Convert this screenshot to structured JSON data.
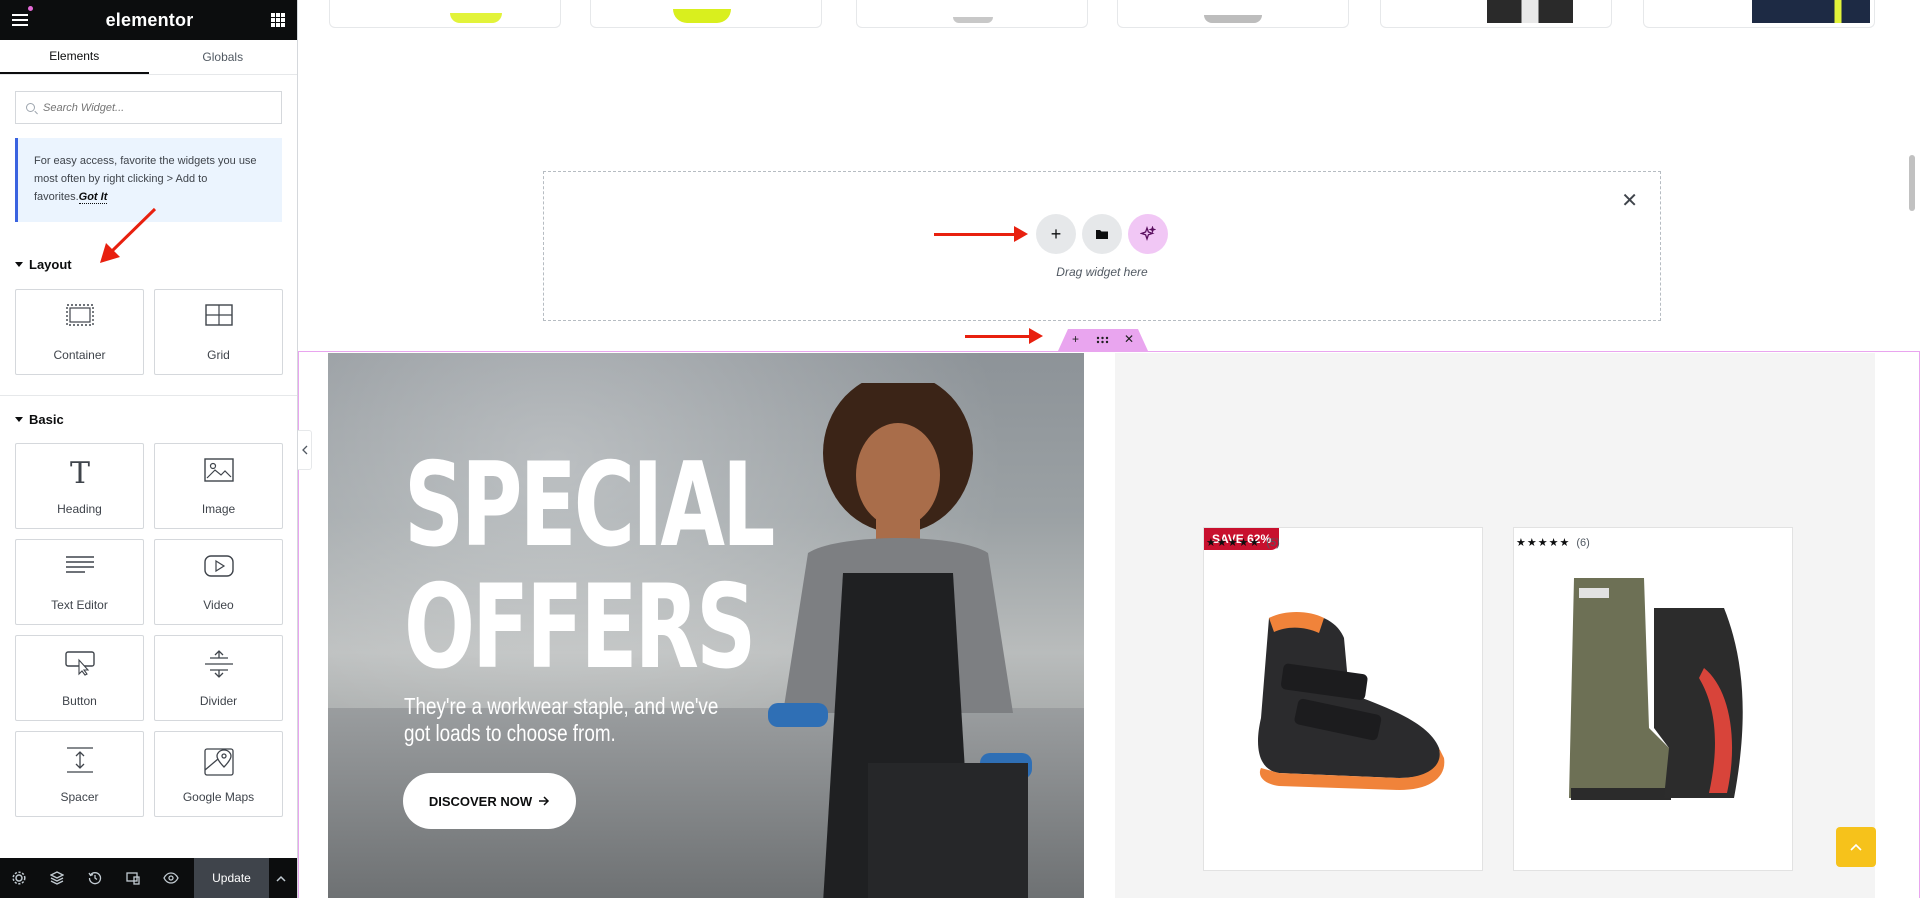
{
  "panel": {
    "logo": "elementor",
    "tabs": [
      {
        "label": "Elements",
        "active": true
      },
      {
        "label": "Globals",
        "active": false
      }
    ],
    "search": {
      "placeholder": "Search Widget..."
    },
    "tip": {
      "text": "For easy access, favorite the widgets you use most often by right clicking > Add to favorites.",
      "link": "Got It"
    },
    "layout": {
      "title": "Layout",
      "widgets": [
        {
          "label": "Container",
          "icon": "container-icon"
        },
        {
          "label": "Grid",
          "icon": "grid-icon"
        }
      ]
    },
    "basic": {
      "title": "Basic",
      "widgets": [
        {
          "label": "Heading",
          "icon": "heading-icon"
        },
        {
          "label": "Image",
          "icon": "image-icon"
        },
        {
          "label": "Text Editor",
          "icon": "text-editor-icon"
        },
        {
          "label": "Video",
          "icon": "video-icon"
        },
        {
          "label": "Button",
          "icon": "button-icon"
        },
        {
          "label": "Divider",
          "icon": "divider-icon"
        },
        {
          "label": "Spacer",
          "icon": "spacer-icon"
        },
        {
          "label": "Google Maps",
          "icon": "map-icon"
        }
      ]
    },
    "footer": {
      "update_label": "Update",
      "icons": [
        "settings-icon",
        "layers-icon",
        "history-icon",
        "responsive-icon",
        "preview-icon"
      ]
    }
  },
  "canvas": {
    "dropzone": {
      "label": "Drag widget here"
    },
    "hero": {
      "title_line1": "SPECIAL",
      "title_line2": "OFFERS",
      "subtitle": "They're a workwear staple, and we've got loads to choose from.",
      "cta": "DISCOVER NOW"
    },
    "products": [
      {
        "badge": "SAVE 62%",
        "rating_count": "(5)",
        "stars": 5
      },
      {
        "badge": "",
        "rating_count": "(6)",
        "stars": 5
      }
    ]
  },
  "colors": {
    "accent_red": "#e8200f",
    "section_pink": "#e9a5ef",
    "badge_red": "#c8102e",
    "scroll_top_yellow": "#f6c21b"
  }
}
